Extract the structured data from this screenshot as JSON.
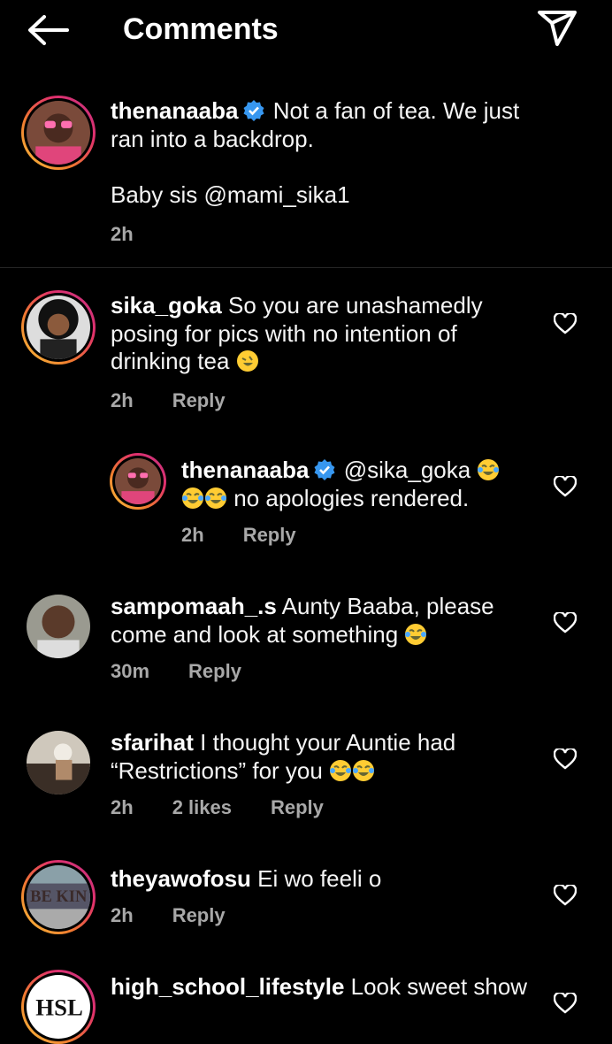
{
  "header": {
    "title": "Comments"
  },
  "caption": {
    "username": "thenanaaba",
    "text_line1": "Not a fan of tea. We just",
    "text_line2": "ran into a backdrop.",
    "text_line3": "Baby sis @mami_sika1",
    "time": "2h"
  },
  "comments": [
    {
      "username": "sika_goka",
      "line1": "So you are unashamedly",
      "line2": "posing for pics  with no intention of",
      "line3": "drinking tea",
      "time": "2h",
      "reply": "Reply"
    },
    {
      "username": "thenanaaba",
      "line1": "@sika_goka",
      "line2": "no apologies rendered.",
      "time": "2h",
      "reply": "Reply"
    },
    {
      "username": "sampomaah_.s",
      "line1": "Aunty Baaba, please",
      "line2": "come and look at something",
      "time": "30m",
      "reply": "Reply"
    },
    {
      "username": "sfarihat",
      "line1": "I thought your Auntie had",
      "line2": "“Restrictions” for you",
      "time": "2h",
      "likes": "2 likes",
      "reply": "Reply"
    },
    {
      "username": "theyawofosu",
      "line1": "Ei wo feeli o",
      "time": "2h",
      "reply": "Reply"
    },
    {
      "username": "high_school_lifestyle",
      "line1": "Look sweet show"
    }
  ],
  "icons": {
    "back": "back-arrow-icon",
    "send": "send-icon",
    "heart": "heart-outline-icon",
    "verified": "verified-badge-icon"
  },
  "colors": {
    "verified": "#3797f0",
    "meta_text": "#a8a8a8",
    "divider": "#262626"
  }
}
